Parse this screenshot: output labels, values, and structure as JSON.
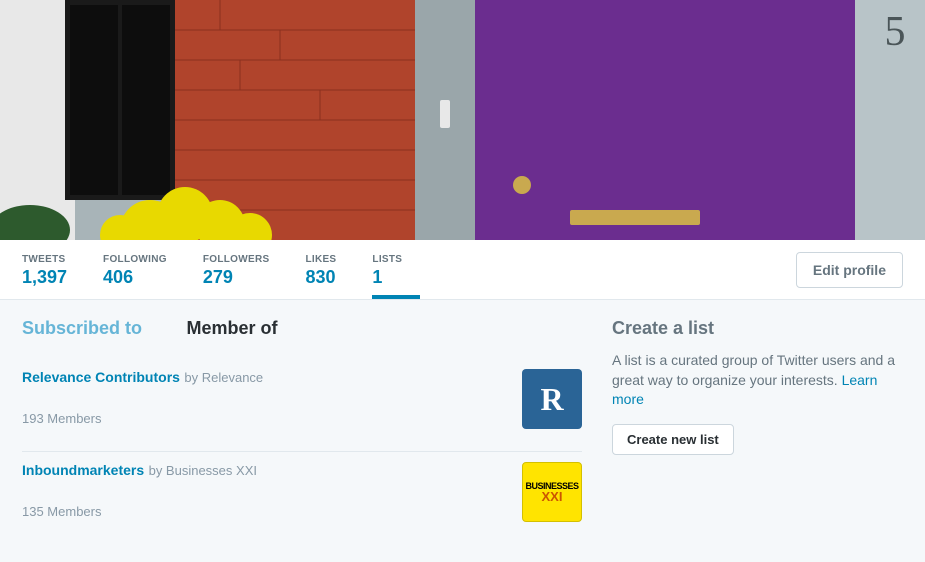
{
  "stats": {
    "tweets": {
      "label": "TWEETS",
      "value": "1,397"
    },
    "following": {
      "label": "FOLLOWING",
      "value": "406"
    },
    "followers": {
      "label": "FOLLOWERS",
      "value": "279"
    },
    "likes": {
      "label": "LIKES",
      "value": "830"
    },
    "lists": {
      "label": "LISTS",
      "value": "1"
    }
  },
  "edit_profile": "Edit profile",
  "tabs": {
    "subscribed": "Subscribed to",
    "member": "Member of"
  },
  "lists_items": [
    {
      "title": "Relevance Contributors",
      "by": "by Relevance",
      "members": "193 Members",
      "avatar_text": "R"
    },
    {
      "title": "Inboundmarketers",
      "by": "by Businesses XXI",
      "members": "135 Members"
    }
  ],
  "sidebar": {
    "title": "Create a list",
    "desc": "A list is a curated group of Twitter users and a great way to organize your interests. ",
    "learn_more": "Learn more",
    "create_btn": "Create new list"
  }
}
